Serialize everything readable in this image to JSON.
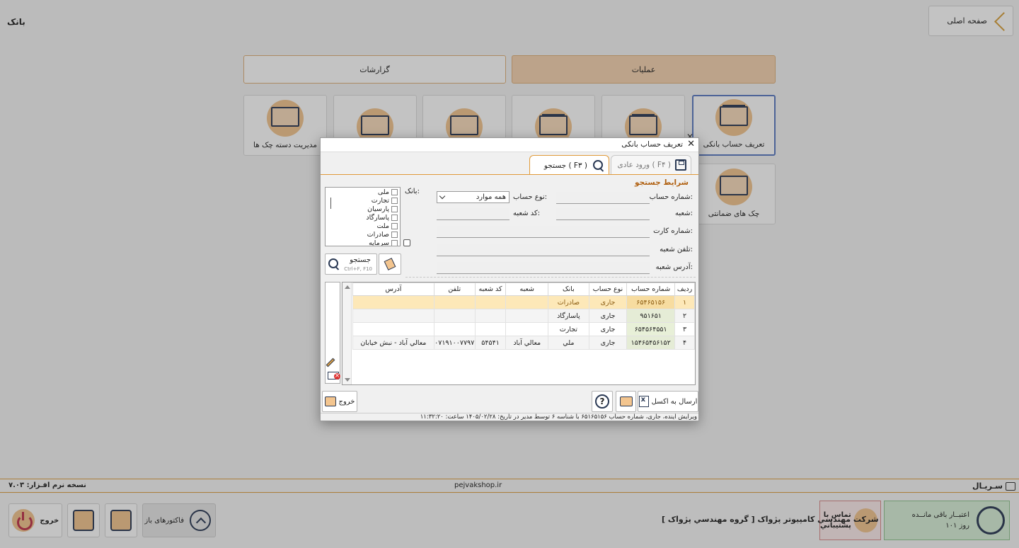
{
  "app": {
    "title": "بانک",
    "home_label": "صفحه اصلی",
    "tabs": {
      "reports": "گزارشات",
      "operations": "عملیات"
    },
    "tiles": [
      {
        "label": "تعریف حساب بانکی"
      },
      {
        "label": ""
      },
      {
        "label": ""
      },
      {
        "label": ""
      },
      {
        "label": ""
      },
      {
        "label": "مدیریت دسته چک ها"
      },
      {
        "label": "چک های ضمانتی"
      }
    ]
  },
  "footer": {
    "version": "نسخه نرم افـزار: ۷.۰۳",
    "site": "pejvakshop.ir",
    "serial": "سـريـال",
    "credit_title": "اعتبــار باقی مانــده",
    "credit_days": "۱۰۱ روز",
    "support_line1": "تماس با",
    "support_line2": "پشتيباني",
    "company": "شرکت مهندسي کامپيوتر پژواک [ گروه مهندسي پژواک ]",
    "factors_label": "فاکتورهای باز",
    "exit_label": "خروج"
  },
  "dialog": {
    "title": "تعریف حساب بانکی",
    "tab_normal": "ورود عادی ( F۴ )",
    "tab_search": "جستجو ( F۳ )",
    "section_title": "شرایط جستجو",
    "labels": {
      "account_number": "شماره حساب:",
      "account_type": "نوع حساب:",
      "bank": "بانک:",
      "branch": "شعبه:",
      "branch_code": "کد شعبه:",
      "card_number": "شماره کارت:",
      "branch_phone": "تلفن شعبه:",
      "branch_address": "آدرس شعبه:"
    },
    "account_type_value": "همه موارد",
    "banks": [
      "ملی",
      "تجارت",
      "پارسیان",
      "پاسارگاد",
      "ملت",
      "صادرات",
      "سرمایه"
    ],
    "search_button": "جستجو",
    "search_shortcut": "Ctrl+F, F10",
    "table": {
      "headers": [
        "ردیف",
        "شماره حساب",
        "نوع حساب",
        "بانک",
        "شعبه",
        "کد شعبه",
        "تلفن",
        "آدرس"
      ],
      "rows": [
        [
          "۱",
          "۶۵۴۶۵۱۵۶",
          "جاری",
          "صادرات",
          "",
          "",
          "",
          ""
        ],
        [
          "۲",
          "۹۵۱۶۵۱",
          "جاری",
          "پاسارگاد",
          "",
          "",
          "",
          ""
        ],
        [
          "۳",
          "۶۵۴۵۶۴۵۵۱",
          "جاری",
          "تجارت",
          "",
          "",
          "",
          ""
        ],
        [
          "۴",
          "۱۵۴۶۵۴۵۶۱۵۲",
          "جاری",
          "ملي",
          "معالي آباد",
          "۵۴۵۴۱",
          "۰۷۱۹۱۰۰۷۷۹۷",
          "معالي آباد - نبش خيابان"
        ]
      ]
    },
    "excel_button": "ارسال به اکسل",
    "exit_button": "خروج",
    "status_text": "ويرايش آينده، جاری، شماره حساب ۶۵۱۶۵۱۵۶ با شناسه ۶ توسط مدير در تاريخ: ۱۴۰۵/۰۲/۲۸ ساعت: ۱۱:۳۲:۲۰"
  }
}
